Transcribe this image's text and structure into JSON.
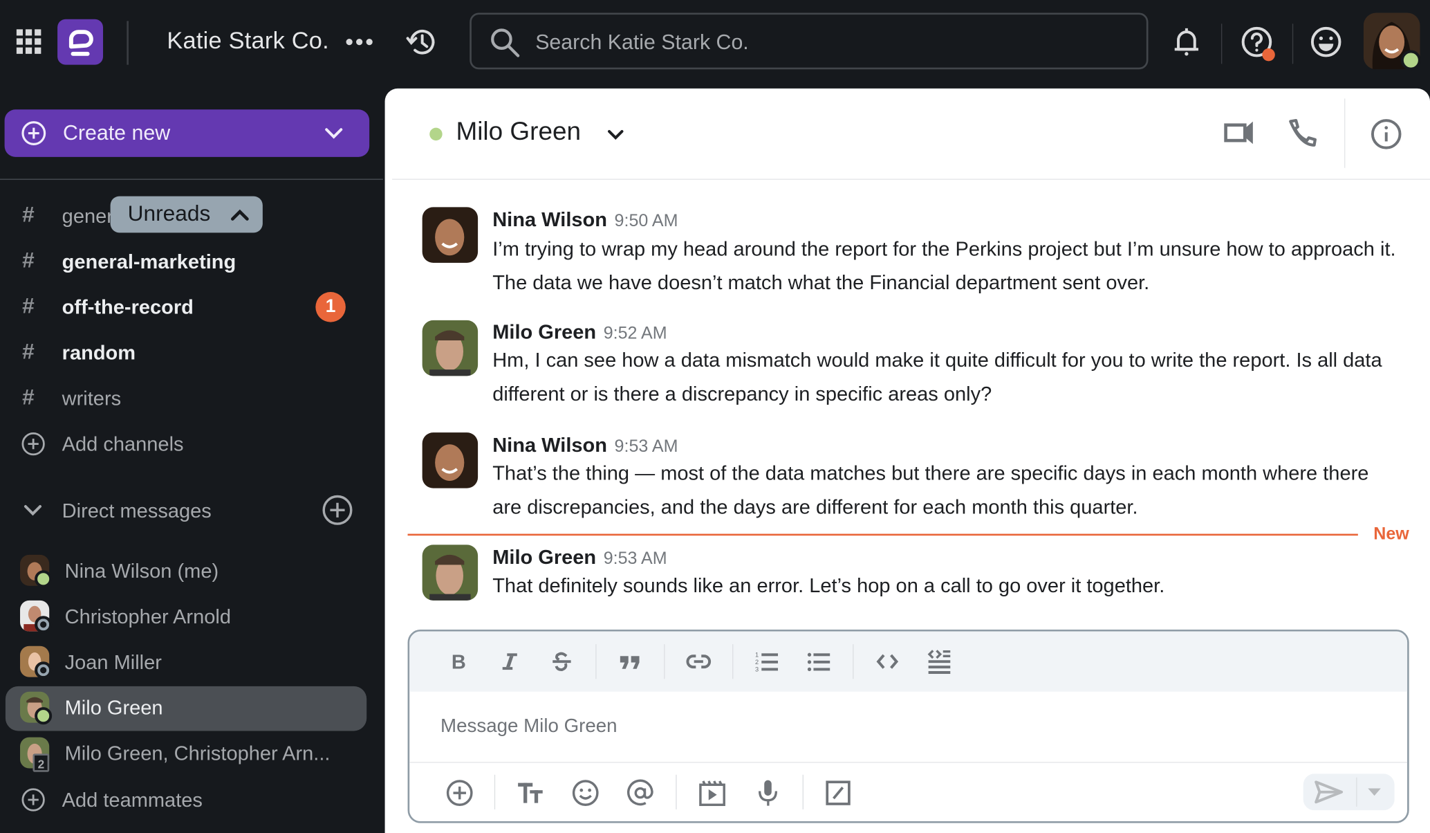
{
  "topbar": {
    "workspace_name": "Katie Stark Co.",
    "search_placeholder": "Search Katie Stark Co.",
    "icons": [
      "apps-grid-icon",
      "app-logo",
      "more-icon",
      "history-icon",
      "search-icon",
      "bell-icon",
      "help-icon",
      "emoji-status-icon",
      "user-avatar"
    ],
    "help_notification": true,
    "user_status": "online"
  },
  "sidebar": {
    "create_new_label": "Create new",
    "unreads_label": "Unreads",
    "channels": [
      {
        "name": "general",
        "unread": false
      },
      {
        "name": "general-marketing",
        "unread": true
      },
      {
        "name": "off-the-record",
        "unread": true,
        "badge": "1"
      },
      {
        "name": "random",
        "unread": true
      },
      {
        "name": "writers",
        "unread": false
      }
    ],
    "add_channels_label": "Add channels",
    "dm_header": "Direct messages",
    "direct_messages": [
      {
        "name": "Nina Wilson (me)",
        "status": "online"
      },
      {
        "name": "Christopher Arnold",
        "status": "away"
      },
      {
        "name": "Joan Miller",
        "status": "away"
      },
      {
        "name": "Milo Green",
        "status": "online",
        "active": true
      },
      {
        "name": "Milo Green, Christopher Arn...",
        "status": "group",
        "count": "2"
      }
    ],
    "add_teammates_label": "Add teammates"
  },
  "channel_header": {
    "name": "Milo Green",
    "status": "online"
  },
  "messages": [
    {
      "author": "Nina Wilson",
      "time": "9:50 AM",
      "text": "I’m trying to wrap my head around the report for the Perkins project but I’m unsure how to approach it. The data we have doesn’t match what the Financial department sent over."
    },
    {
      "author": "Milo Green",
      "time": "9:52 AM",
      "text": "Hm, I can see how a data mismatch would make it quite difficult for you to write the report. Is all data different or is there a discrepancy in specific areas only?"
    },
    {
      "author": "Nina Wilson",
      "time": "9:53 AM",
      "text": "That’s the thing — most of the data matches but there are specific days in each month where there are discrepancies, and the days are different for each month this quarter."
    },
    {
      "author": "Milo Green",
      "time": "9:53 AM",
      "text": "That definitely sounds like an error. Let’s hop on a call to go over it together."
    }
  ],
  "new_divider_label": "New",
  "composer": {
    "placeholder": "Message Milo Green",
    "format_tools": [
      "bold",
      "italic",
      "strikethrough",
      "quote",
      "link",
      "numbered-list",
      "bulleted-list",
      "code",
      "code-block"
    ],
    "action_tools": [
      "attach",
      "formatting",
      "emoji",
      "mention",
      "video-clip",
      "voice",
      "slash-command"
    ]
  },
  "colors": {
    "accent": "#6439b1",
    "online": "#b3d58a",
    "alert": "#e9663a",
    "away": "#97a5b0"
  }
}
